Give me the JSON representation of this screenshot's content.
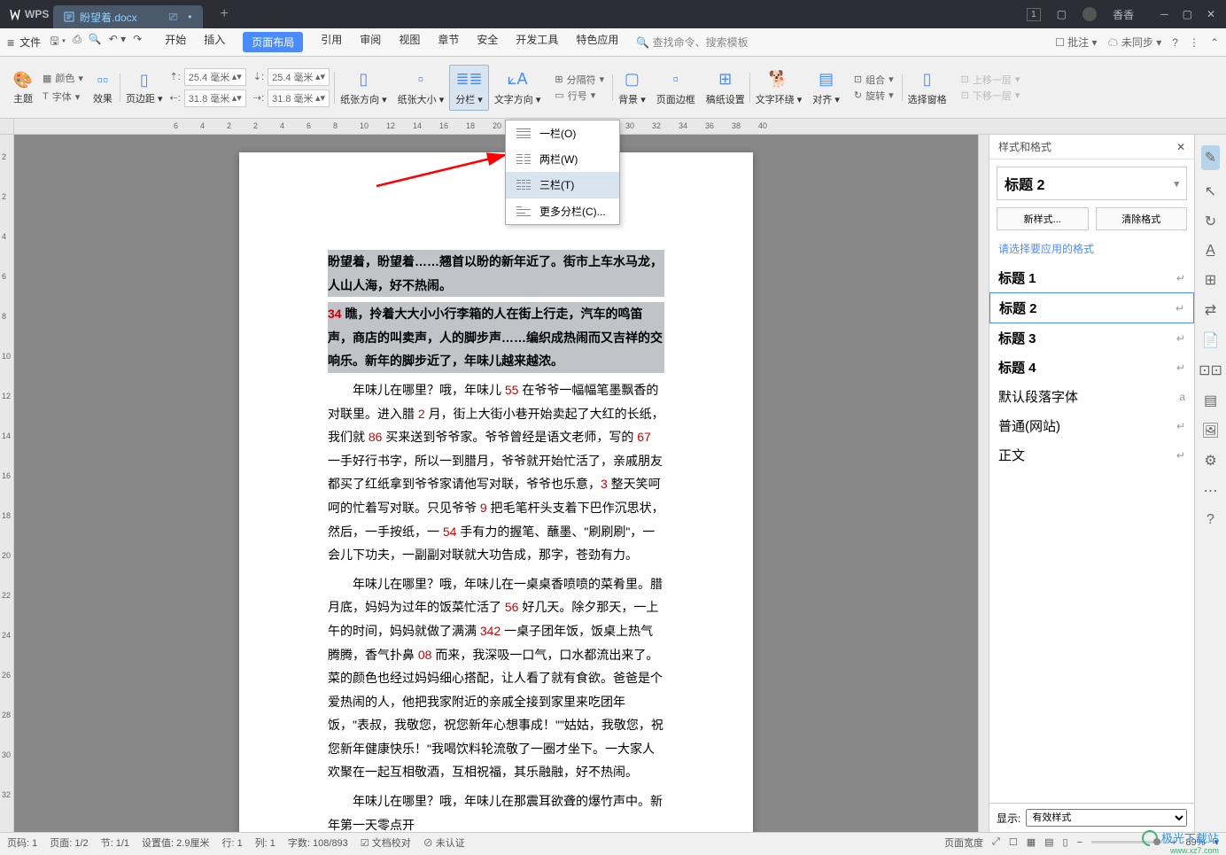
{
  "title_bar": {
    "wps_label": "WPS",
    "doc_tab": "盼望着.docx",
    "user_name": "香香"
  },
  "menu": {
    "file": "文件",
    "tabs": [
      "开始",
      "插入",
      "页面布局",
      "引用",
      "审阅",
      "视图",
      "章节",
      "安全",
      "开发工具",
      "特色应用"
    ],
    "active_index": 2,
    "search": "查找命令、搜索模板",
    "right": {
      "approve": "批注",
      "unsync": "未同步"
    }
  },
  "ribbon": {
    "theme": "主题",
    "color": "颜色",
    "font": "字体",
    "effect": "效果",
    "margin": "页边距",
    "top_m": "25.4 毫米",
    "top_m2": "25.4 毫米",
    "bot_m": "31.8 毫米",
    "bot_m2": "31.8 毫米",
    "orient": "纸张方向",
    "size": "纸张大小",
    "columns": "分栏",
    "textdir": "文字方向",
    "breaks": "分隔符",
    "lineno": "行号",
    "bg": "背景",
    "border": "页面边框",
    "grid": "稿纸设置",
    "wrap": "文字环绕",
    "align": "对齐",
    "rotate": "旋转",
    "selpane": "选择窗格",
    "group": "组合",
    "up": "上移一层",
    "down": "下移一层"
  },
  "columns_menu": {
    "one": "一栏(O)",
    "two": "两栏(W)",
    "three": "三栏(T)",
    "more": "更多分栏(C)..."
  },
  "ruler_h": [
    "6",
    "4",
    "2",
    "2",
    "4",
    "6",
    "8",
    "10",
    "12",
    "14",
    "16",
    "18",
    "20",
    "22",
    "24",
    "26",
    "28",
    "30",
    "32",
    "34",
    "36",
    "38",
    "40"
  ],
  "ruler_v": [
    "2",
    "2",
    "4",
    "6",
    "8",
    "10",
    "12",
    "14",
    "16",
    "18",
    "20",
    "22",
    "24",
    "26",
    "28",
    "30",
    "32"
  ],
  "doc": {
    "p1": "盼望着，盼望着……翘首以盼的新年近了。街市上车水马龙，人山人海，好不热闹。",
    "p2a": "34 瞧，拎着大大小小行李箱的人在街上行走，汽车的鸣笛声，商店的叫卖声，人的脚步声……编织成热闹而又吉祥的交响乐。新年的脚步近了，年味儿越来越浓。",
    "p3": "年味儿在哪里？哦，年味儿 55 在爷爷一幅幅笔墨飘香的对联里。进入腊 2 月，街上大街小巷开始卖起了大红的长纸，我们就 86 买来送到爷爷家。爷爷曾经是语文老师，写的 67 一手好行书字，所以一到腊月，爷爷就开始忙活了，亲戚朋友都买了红纸拿到爷爷家请他写对联，爷爷也乐意，3 整天笑呵呵的忙着写对联。只见爷爷 9 把毛笔杆头支着下巴作沉思状，然后，一手按纸，一 54 手有力的握笔、蘸墨、\"刷刷刷\"，一会儿下功夫，一副副对联就大功告成，那字，苍劲有力。",
    "p4": "年味儿在哪里？哦，年味儿在一桌桌香喷喷的菜肴里。腊月底，妈妈为过年的饭菜忙活了 56 好几天。除夕那天，一上午的时间，妈妈就做了满满 342 一桌子团年饭，饭桌上热气腾腾，香气扑鼻 08 而来，我深吸一口气，口水都流出来了。菜的颜色也经过妈妈细心搭配，让人看了就有食欲。爸爸是个爱热闹的人，他把我家附近的亲戚全接到家里来吃团年饭，\"表叔，我敬您，祝您新年心想事成！\"\"姑姑，我敬您，祝您新年健康快乐！\"我喝饮料轮流敬了一圈才坐下。一大家人欢聚在一起互相敬酒，互相祝福，其乐融融，好不热闹。",
    "p5": "年味儿在哪里？哦，年味儿在那震耳欲聋的爆竹声中。新年第一天零点开"
  },
  "styles": {
    "title": "样式和格式",
    "current": "标题 2",
    "new_btn": "新样式...",
    "clear_btn": "清除格式",
    "prompt": "请选择要应用的格式",
    "items": [
      {
        "name": "标题 1",
        "heading": true
      },
      {
        "name": "标题 2",
        "heading": true,
        "selected": true
      },
      {
        "name": "标题 3",
        "heading": true
      },
      {
        "name": "标题 4",
        "heading": true
      },
      {
        "name": "默认段落字体",
        "heading": false,
        "arrow": "a"
      },
      {
        "name": "普通(网站)",
        "heading": false
      },
      {
        "name": "正文",
        "heading": false
      }
    ],
    "show_lbl": "显示:",
    "show_val": "有效样式"
  },
  "status": {
    "page_no": "页码: 1",
    "page": "页面: 1/2",
    "sec": "节: 1/1",
    "pos": "设置值: 2.9厘米",
    "row": "行: 1",
    "col": "列: 1",
    "words": "字数: 108/893",
    "spell": "文档校对",
    "auth": "未认证",
    "pg_zoom": "页面宽度",
    "zoom": "89%"
  },
  "watermark": {
    "name": "极光下载站",
    "url": "www.xz7.com"
  }
}
